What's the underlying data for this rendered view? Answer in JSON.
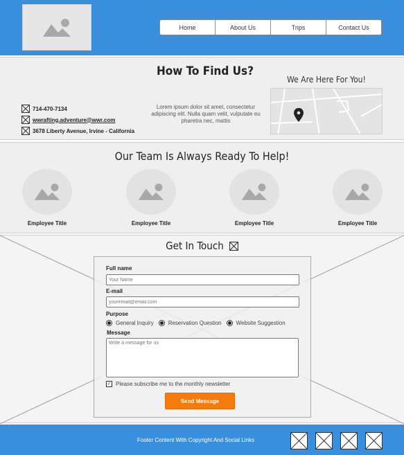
{
  "header": {
    "nav": [
      "Home",
      "About Us",
      "Trips",
      "Contact Us"
    ]
  },
  "find_us": {
    "title": "How To Find Us?",
    "phone": "714-470-7134",
    "email": "wwrafting.adventure@wwr.com",
    "address": "3678 Liberty Avenue, Irvine - California",
    "lorem": "Lorem ipsum dolor sit amet, consectetur adipiscing elit. Nulla quam velit, vulputate eu pharetra nec, mattis",
    "here_title": "We Are Here For You!"
  },
  "team": {
    "title": "Our Team Is Always Ready To Help!",
    "employees": [
      "Employee Title",
      "Employee Title",
      "Employee Title",
      "Employee Title"
    ]
  },
  "contact": {
    "title": "Get In Touch",
    "fullname_label": "Full name",
    "fullname_placeholder": "Your Name",
    "email_label": "E-mail",
    "email_placeholder": "youremail@email.com",
    "purpose_label": "Purpose",
    "purposes": [
      "General Inquiry",
      "Reservation Question",
      "Website Suggestion"
    ],
    "message_label": "Message",
    "message_placeholder": "Write a message for us",
    "subscribe_label": "Please subscribe me to the monthly newsletter",
    "send_label": "Send Message"
  },
  "footer": {
    "text": "Footer Content With Copyright And Social Links"
  },
  "colors": {
    "brand_blue": "#3a8fdc",
    "accent_orange": "#f47b0a"
  }
}
